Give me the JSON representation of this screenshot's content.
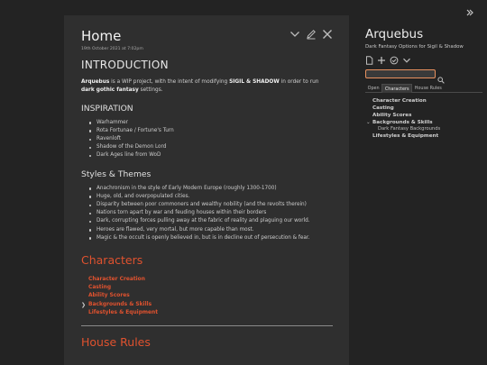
{
  "tiddler": {
    "title": "Home",
    "subtitle": "19th October 2021 at 7:02pm",
    "controls": [
      "chevron-down-icon",
      "edit-icon",
      "close-icon"
    ]
  },
  "intro": {
    "heading": "INTRODUCTION",
    "p_bold1": "Arquebus",
    "p_text1": " is a WIP project, with the intent of modifying ",
    "p_bold2": "SIGIL & SHADOW",
    "p_text2": " in order to run ",
    "p_bold3": "dark gothic fantasy",
    "p_text3": " settings."
  },
  "inspiration": {
    "heading": "INSPIRATION",
    "items": [
      "Warhammer",
      "Rota Fortunae / Fortune's Turn",
      "Ravenloft",
      "Shadow of the Demon Lord",
      "Dark Ages line from WoD"
    ]
  },
  "styles": {
    "heading": "Styles & Themes",
    "items": [
      "Anachronism in the style of Early Modern Europe (roughly 1300-1700)",
      "Huge, old, and overpopulated cities.",
      "Disparity between poor commoners and wealthy nobility (and the revolts therein)",
      "Nations torn apart by war and feuding houses within their borders",
      "Dark, corrupting forces pulling away at the fabric of reality and plaguing our world.",
      "Heroes are flawed, very mortal, but more capable than most.",
      "Magic & the occult is openly believed in, but is in decline out of persecution & fear."
    ]
  },
  "characters": {
    "heading": "Characters",
    "toc": [
      "Character Creation",
      "Casting",
      "Ability Scores",
      "Backgrounds & Skills",
      "Lifestyles & Equipment"
    ],
    "caret": "❯"
  },
  "house_rules": {
    "heading": "House Rules"
  },
  "sidebar": {
    "title": "Arquebus",
    "subtitle": "Dark Fantasy Options for Sigil & Shadow",
    "tools": [
      "document-icon",
      "plus-icon",
      "check-circle-icon",
      "chevron-down-icon"
    ],
    "search": {
      "value": "",
      "placeholder": ""
    },
    "tabs": [
      "Open",
      "Characters",
      "House Rules"
    ],
    "active_tab": "Characters",
    "toc": [
      "Character Creation",
      "Casting",
      "Ability Scores",
      "Backgrounds & Skills",
      "Lifestyles & Equipment"
    ],
    "toc_sub": "Dark Fantasy Backgrounds",
    "caret": "⌄"
  },
  "colors": {
    "accent": "#e0522f",
    "search_border": "#e8915f",
    "page_bg": "#232323",
    "card_bg": "#2f2f2f"
  }
}
